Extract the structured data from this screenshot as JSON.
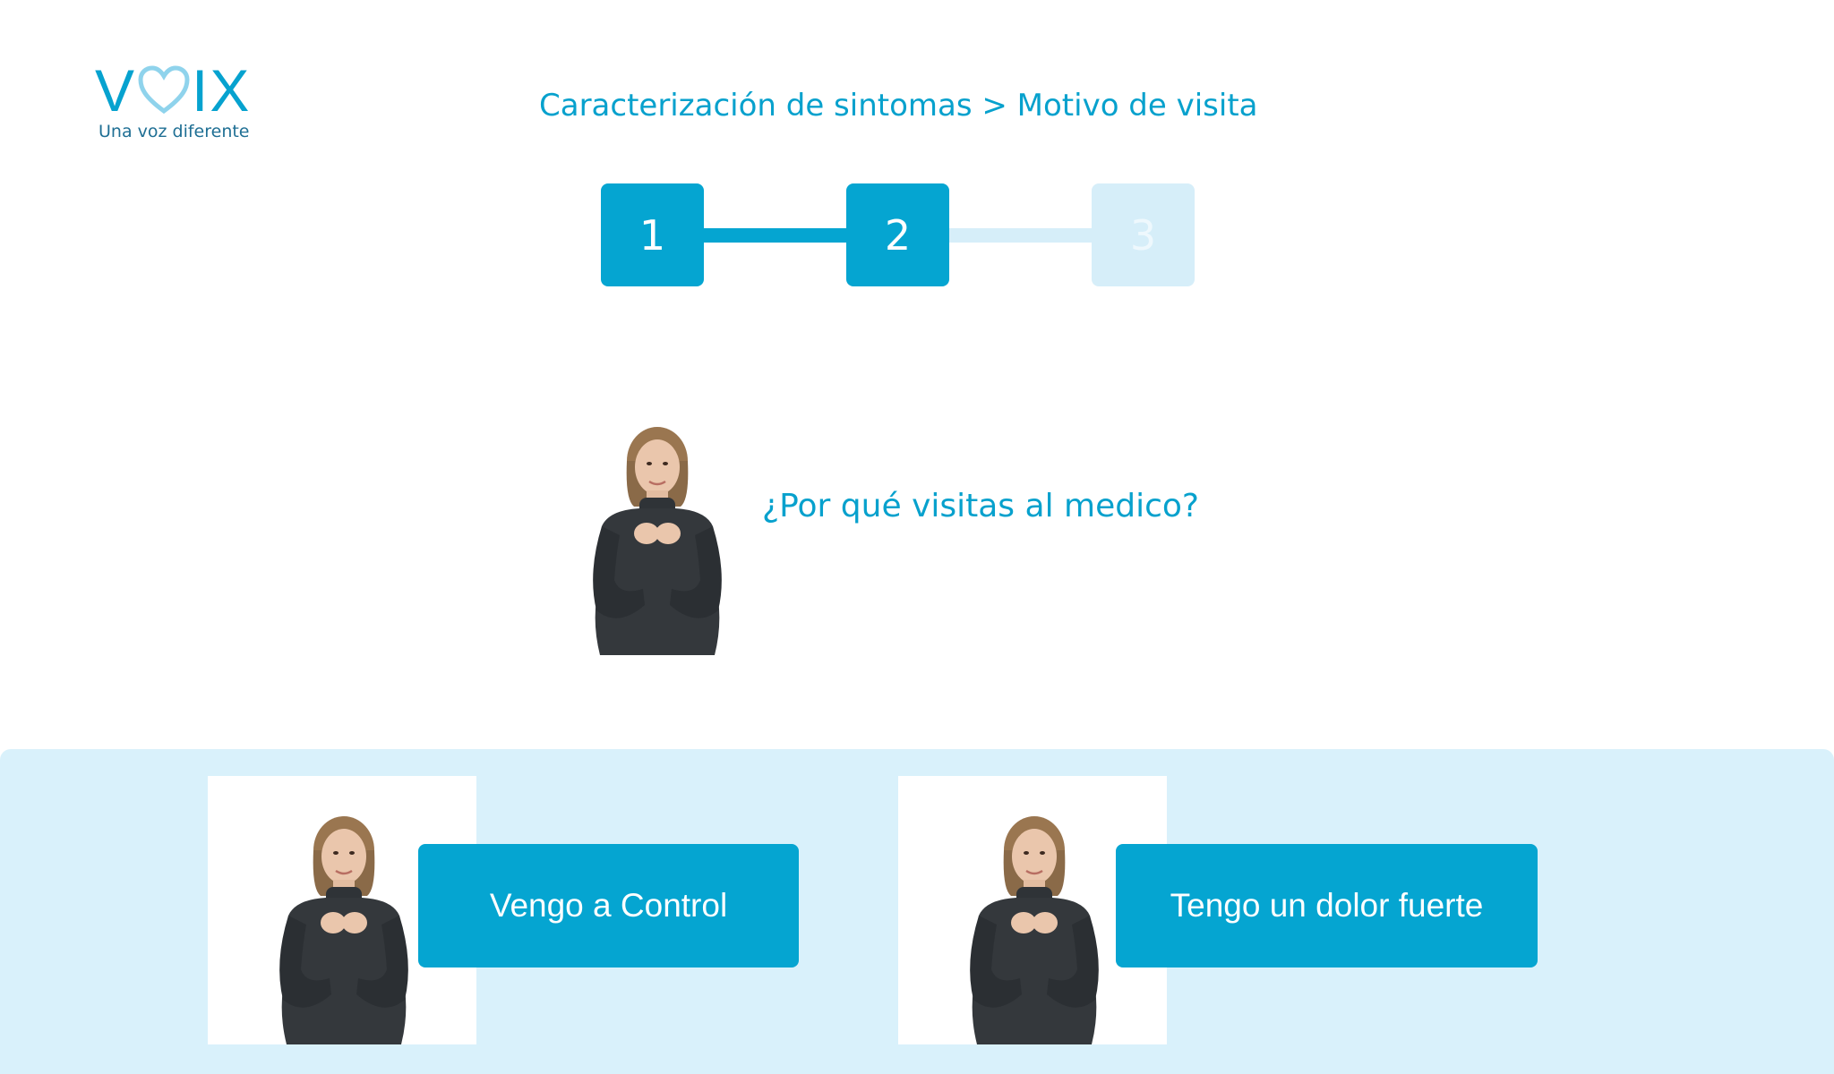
{
  "brand": {
    "logo_text_left": "V",
    "logo_text_right": "IX",
    "tagline": "Una voz diferente",
    "logo_color": "#06a2cf",
    "heart_color": "#8fd3ec",
    "logo_icon": "heart-icon"
  },
  "breadcrumb": {
    "text": "Caracterización de sintomas > Motivo de visita"
  },
  "stepper": {
    "current_step": 2,
    "steps": [
      {
        "label": "1",
        "state": "active"
      },
      {
        "label": "2",
        "state": "active"
      },
      {
        "label": "3",
        "state": "inactive"
      }
    ],
    "active_color": "#05a5d1",
    "inactive_color": "#d6eef9"
  },
  "question": {
    "text": "¿Por qué visitas al medico?"
  },
  "answers": [
    {
      "label": "Vengo a Control"
    },
    {
      "label": "Tengo un dolor fuerte"
    }
  ],
  "colors": {
    "accent": "#05a5d1",
    "panel_background": "#d9f1fb",
    "text_accent": "#07a1cd"
  }
}
